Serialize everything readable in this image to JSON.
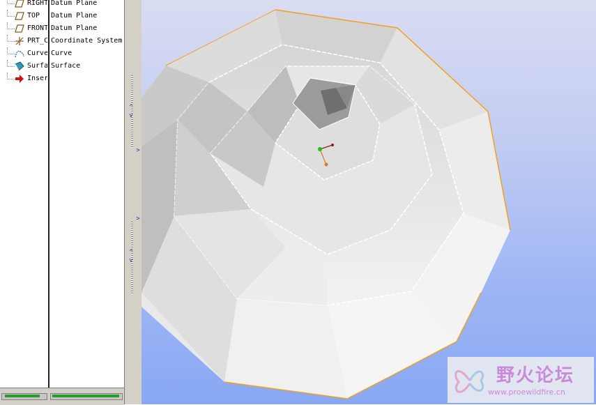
{
  "model_tree": {
    "items": [
      {
        "label": "RIGHT",
        "type": "Datum Plane",
        "icon": "datum-plane-icon"
      },
      {
        "label": "TOP",
        "type": "Datum Plane",
        "icon": "datum-plane-icon"
      },
      {
        "label": "FRONT",
        "type": "Datum Plane",
        "icon": "datum-plane-icon"
      },
      {
        "label": "PRT_C",
        "type": "Coordinate System",
        "icon": "coordinate-system-icon"
      },
      {
        "label": "Curve",
        "type": "Curve",
        "icon": "curve-icon"
      },
      {
        "label": "Surfa",
        "type": "Surface",
        "icon": "surface-icon"
      },
      {
        "label": "Inser",
        "type": "",
        "icon": "insert-here-arrow-icon"
      }
    ]
  },
  "watermark": {
    "title": "野火论坛",
    "url": "www.proewildfire.cn"
  },
  "colors": {
    "insert_arrow": "#cc1111",
    "edge_highlight": "#f2a020",
    "plane_icon": "#8a5a1a"
  }
}
